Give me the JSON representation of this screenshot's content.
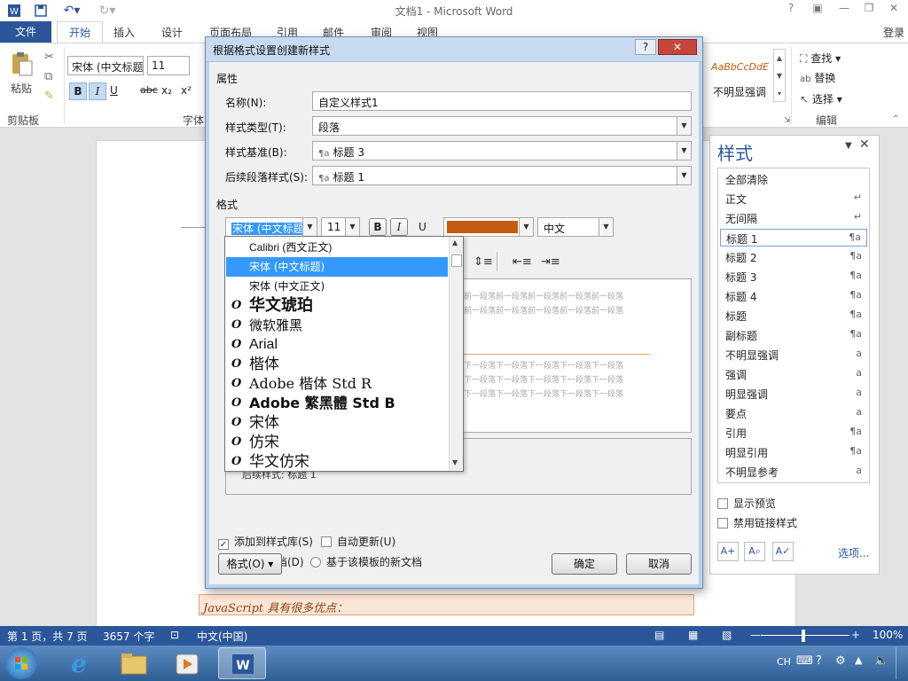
{
  "window": {
    "title": "文档1 - Microsoft Word"
  },
  "ribbon": {
    "tabs": [
      "文件",
      "开始",
      "插入",
      "设计",
      "页面布局",
      "引用",
      "邮件",
      "审阅",
      "视图"
    ],
    "login": "登录",
    "paste": "粘贴",
    "clipboard_group": "剪贴板",
    "font_group": "字体",
    "font_name": "宋体 (中文标题",
    "font_size": "11",
    "bold": "B",
    "italic": "I",
    "underline": "U",
    "strike": "abc",
    "subscript": "x₂",
    "superscript": "x²",
    "style_sample": "AaBbCcDdE",
    "style_sample_name": "不明显强调",
    "find": "查找",
    "replace": "替换",
    "select": "选择",
    "edit_group": "编辑"
  },
  "dialog": {
    "title": "根据格式设置创建新样式",
    "help": "?",
    "close": "✕",
    "section_props": "属性",
    "name_label": "名称(N):",
    "name_value": "自定义样式1",
    "type_label": "样式类型(T):",
    "type_value": "段落",
    "base_label": "样式基准(B):",
    "base_value": "标题 3",
    "next_label": "后续段落样式(S):",
    "next_value": "标题 1",
    "section_format": "格式",
    "fmt_font": "宋体 (中文标题)",
    "fmt_size": "11",
    "fmt_bold": "B",
    "fmt_italic": "I",
    "fmt_underline": "U",
    "fmt_lang": "中文",
    "font_color": "#c55a11",
    "preview_prev": "前一段落前一段落前一段落前一段落前一段落",
    "preview_next": "下一段落下一段落下一段落下一段落下一段落",
    "desc_text": "后续样式: 标题 1",
    "add_to_gallery": "添加到样式库(S)",
    "auto_update": "自动更新(U)",
    "only_this_doc": "仅限此文档(D)",
    "new_from_template": "基于该模板的新文档",
    "format_button": "格式(O) ▾",
    "ok": "确定",
    "cancel": "取消"
  },
  "fontlist": [
    {
      "name": "Calibri (西文正文)",
      "icon": ""
    },
    {
      "name": "宋体 (中文标题)",
      "icon": ""
    },
    {
      "name": "宋体 (中文正文)",
      "icon": ""
    },
    {
      "name": "华文琥珀",
      "icon": "O"
    },
    {
      "name": "微软雅黑",
      "icon": "O"
    },
    {
      "name": "Arial",
      "icon": "O"
    },
    {
      "name": "楷体",
      "icon": "O"
    },
    {
      "name": "Adobe 楷体 Std R",
      "icon": "O"
    },
    {
      "name": "Adobe 繁黑體 Std B",
      "icon": "O"
    },
    {
      "name": "宋体",
      "icon": "O"
    },
    {
      "name": "仿宋",
      "icon": "O"
    },
    {
      "name": "华文仿宋",
      "icon": "O"
    }
  ],
  "styles_pane": {
    "title": "样式",
    "items": [
      {
        "name": "全部清除",
        "mark": ""
      },
      {
        "name": "正文",
        "mark": "↵"
      },
      {
        "name": "无间隔",
        "mark": "↵"
      },
      {
        "name": "标题 1",
        "mark": "¶a"
      },
      {
        "name": "标题 2",
        "mark": "¶a"
      },
      {
        "name": "标题 3",
        "mark": "¶a"
      },
      {
        "name": "标题 4",
        "mark": "¶a"
      },
      {
        "name": "标题",
        "mark": "¶a"
      },
      {
        "name": "副标题",
        "mark": "¶a"
      },
      {
        "name": "不明显强调",
        "mark": "a"
      },
      {
        "name": "强调",
        "mark": "a"
      },
      {
        "name": "明显强调",
        "mark": "a"
      },
      {
        "name": "要点",
        "mark": "a"
      },
      {
        "name": "引用",
        "mark": "¶a"
      },
      {
        "name": "明显引用",
        "mark": "¶a"
      },
      {
        "name": "不明显参考",
        "mark": "a"
      }
    ],
    "show_preview": "显示预览",
    "disable_linked": "禁用链接样式",
    "options": "选项..."
  },
  "document": {
    "text": "JavaScript 具有很多优点："
  },
  "status": {
    "page": "第 1 页，共 7 页",
    "words": "3657 个字",
    "lang": "中文(中国)",
    "zoom": "100%"
  },
  "taskbar": {
    "ime": "CH"
  }
}
